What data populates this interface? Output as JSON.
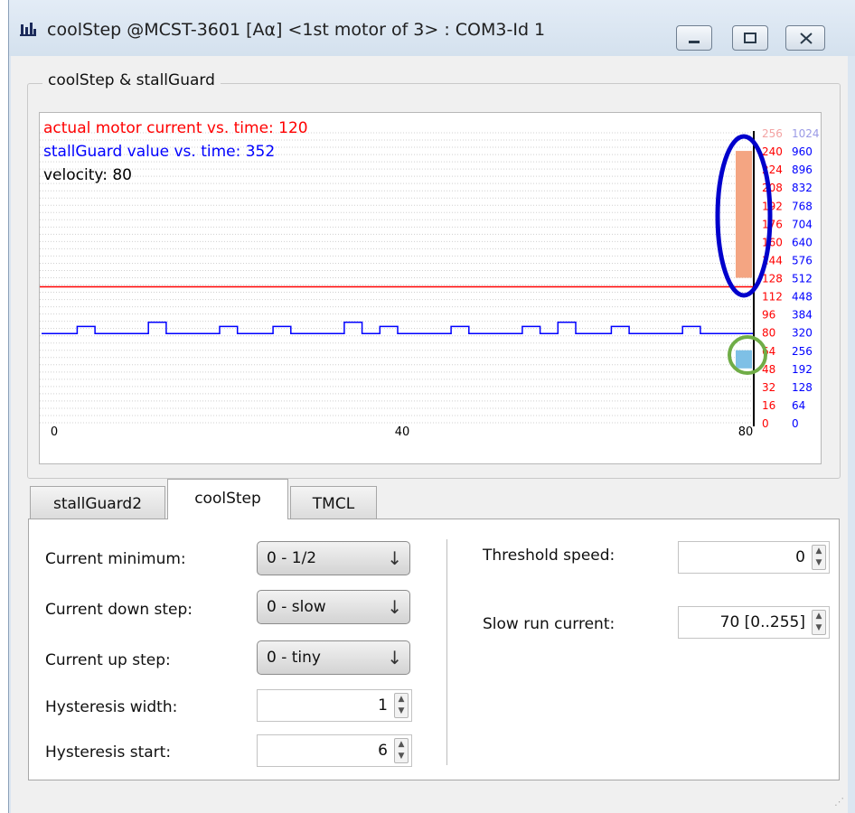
{
  "window": {
    "title": "coolStep @MCST-3601 [Aα] <1st motor of 3> : COM3-Id 1",
    "icons": {
      "app": "bar-chart-icon",
      "minimize": "minimize-icon",
      "maximize": "maximize-icon",
      "close": "close-icon"
    }
  },
  "group": {
    "title": "coolStep & stallGuard"
  },
  "chart_data": {
    "type": "line",
    "legend": [
      {
        "text": "actual motor current vs. time: 120",
        "color": "#ff0000"
      },
      {
        "text": "stallGuard value vs. time: 352",
        "color": "#0000ff"
      },
      {
        "text": "velocity: 80",
        "color": "#000000"
      }
    ],
    "x_ticks": [
      "0",
      "40",
      "80"
    ],
    "xlim": [
      0,
      80
    ],
    "y_ticks_current": [
      "256",
      "240",
      "224",
      "208",
      "192",
      "176",
      "160",
      "144",
      "128",
      "112",
      "96",
      "80",
      "64",
      "48",
      "32",
      "16",
      "0"
    ],
    "y_ticks_stallguard": [
      "1024",
      "960",
      "896",
      "832",
      "768",
      "704",
      "640",
      "576",
      "512",
      "448",
      "384",
      "320",
      "256",
      "192",
      "128",
      "64",
      "0"
    ],
    "ylim_current": [
      0,
      256
    ],
    "ylim_stallguard": [
      0,
      1024
    ],
    "series": [
      {
        "name": "actual motor current vs. time",
        "color": "#ff0000",
        "values": [
          120,
          120
        ]
      },
      {
        "name": "stallGuard value vs. time",
        "color": "#0000ff",
        "values": [
          315,
          315,
          340,
          315,
          315,
          315,
          355,
          315,
          315,
          315,
          340,
          315,
          315,
          340,
          315,
          315,
          315,
          355,
          315,
          340,
          315,
          315,
          315,
          340,
          315,
          315,
          315,
          340,
          315,
          355,
          315,
          315,
          340,
          315,
          315,
          315,
          340,
          315,
          315,
          315
        ]
      }
    ],
    "indicators": [
      {
        "name": "stallGuard bar",
        "range": [
          128,
          240
        ],
        "scale": "current",
        "color": "#f4a582"
      },
      {
        "name": "current bar",
        "range": [
          48,
          64
        ],
        "scale": "current",
        "color": "#7ec0e6"
      }
    ],
    "grid": true
  },
  "tabs": [
    {
      "label": "stallGuard2",
      "active": false
    },
    {
      "label": "coolStep",
      "active": true
    },
    {
      "label": "TMCL",
      "active": false
    }
  ],
  "coolstep": {
    "current_minimum": {
      "label": "Current minimum:",
      "value": "0 - 1/2"
    },
    "current_down_step": {
      "label": "Current down step:",
      "value": "0 - slow"
    },
    "current_up_step": {
      "label": "Current up step:",
      "value": "0 - tiny"
    },
    "hysteresis_width": {
      "label": "Hysteresis width:",
      "value": "1"
    },
    "hysteresis_start": {
      "label": "Hysteresis start:",
      "value": "6"
    },
    "threshold_speed": {
      "label": "Threshold speed:",
      "value": "0"
    },
    "slow_run_current": {
      "label": "Slow run current:",
      "value": "70 [0..255]"
    }
  }
}
